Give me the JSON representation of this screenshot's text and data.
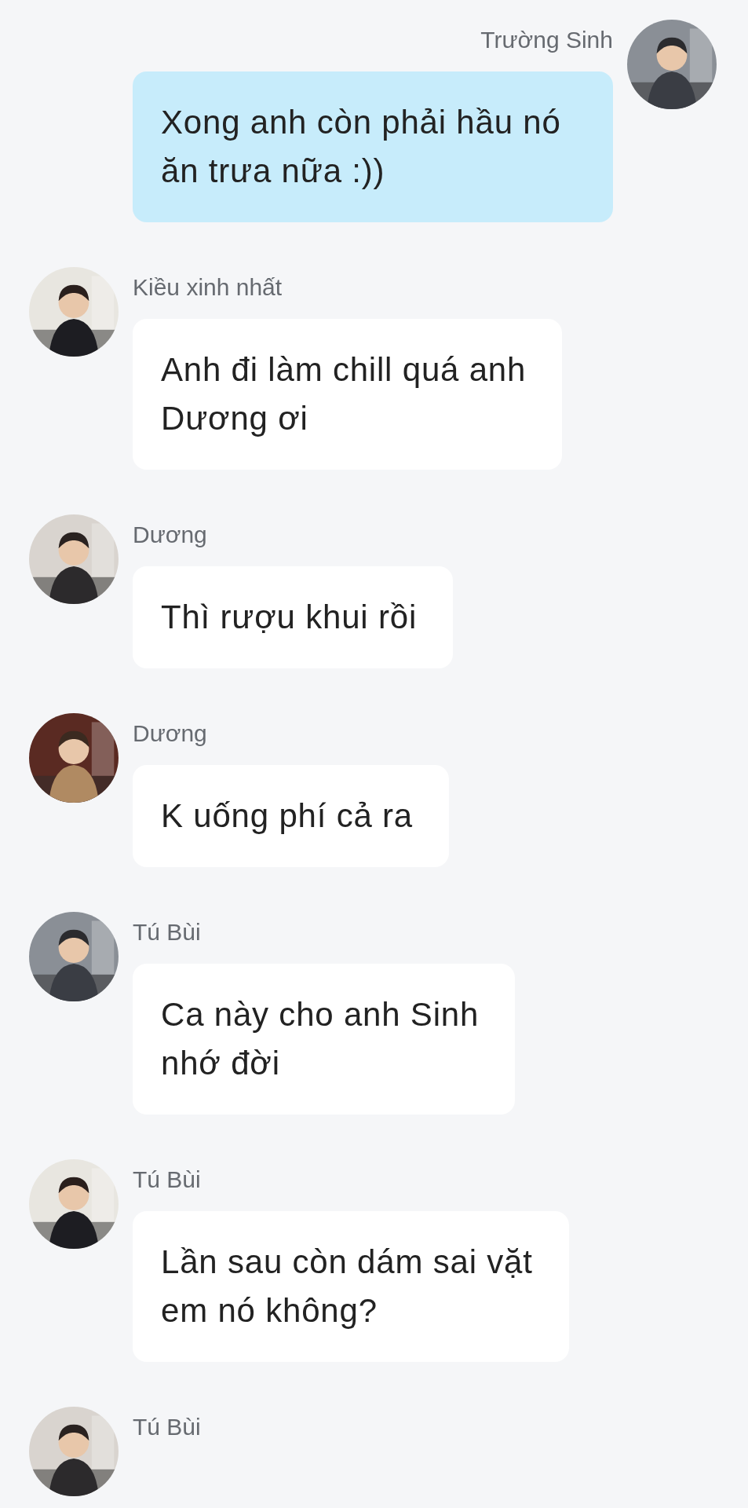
{
  "messages": [
    {
      "sender": "Trường Sinh",
      "own": true,
      "text": "Xong anh còn phải hầu nó\năn trưa nữa :))"
    },
    {
      "sender": "Kiều xinh nhất",
      "own": false,
      "text": "Anh đi làm chill quá anh\nDương ơi"
    },
    {
      "sender": "Dương",
      "own": false,
      "text": "Thì rượu khui rồi"
    },
    {
      "sender": "Dương",
      "own": false,
      "text": "K uống phí cả ra"
    },
    {
      "sender": "Tú Bùi",
      "own": false,
      "text": "Ca này cho anh Sinh\nnhớ đời"
    },
    {
      "sender": "Tú Bùi",
      "own": false,
      "text": "Lần sau còn dám sai vặt\nem nó không?"
    },
    {
      "sender": "Tú Bùi",
      "own": false
    }
  ]
}
